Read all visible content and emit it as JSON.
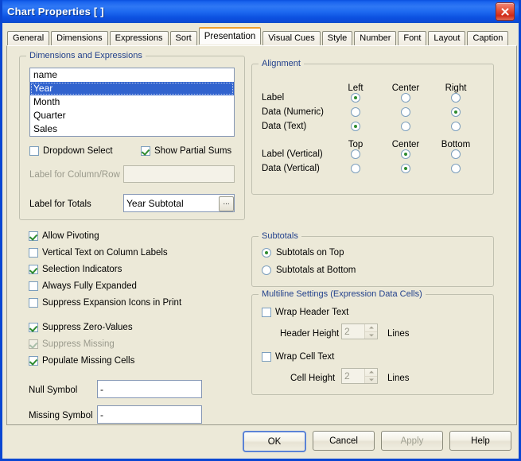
{
  "window": {
    "title": "Chart Properties [ ]",
    "close_icon": "close-icon"
  },
  "tabs": [
    {
      "label": "General",
      "active": false
    },
    {
      "label": "Dimensions",
      "active": false
    },
    {
      "label": "Expressions",
      "active": false
    },
    {
      "label": "Sort",
      "active": false
    },
    {
      "label": "Presentation",
      "active": true
    },
    {
      "label": "Visual Cues",
      "active": false
    },
    {
      "label": "Style",
      "active": false
    },
    {
      "label": "Number",
      "active": false
    },
    {
      "label": "Font",
      "active": false
    },
    {
      "label": "Layout",
      "active": false
    },
    {
      "label": "Caption",
      "active": false
    }
  ],
  "dimensions_group": {
    "legend": "Dimensions and Expressions",
    "list_items": [
      {
        "label": "name",
        "selected": false
      },
      {
        "label": "Year",
        "selected": true
      },
      {
        "label": "Month",
        "selected": false
      },
      {
        "label": "Quarter",
        "selected": false
      },
      {
        "label": "Sales",
        "selected": false
      }
    ],
    "dropdown_select": {
      "label": "Dropdown Select",
      "checked": false
    },
    "show_partial_sums": {
      "label": "Show Partial Sums",
      "checked": true
    },
    "label_column_row": {
      "label": "Label for Column/Row",
      "value": "",
      "disabled": true
    },
    "label_for_totals": {
      "label": "Label for Totals",
      "value": "Year Subtotal",
      "browse": "..."
    }
  },
  "alignment_group": {
    "legend": "Alignment",
    "headers_horizontal": [
      "Left",
      "Center",
      "Right"
    ],
    "headers_vertical": [
      "Top",
      "Center",
      "Bottom"
    ],
    "rows": [
      {
        "label": "Label",
        "selected": 0
      },
      {
        "label": "Data (Numeric)",
        "selected": 2
      },
      {
        "label": "Data (Text)",
        "selected": 0
      },
      {
        "label": "Label (Vertical)",
        "selected": 1
      },
      {
        "label": "Data (Vertical)",
        "selected": 1
      }
    ]
  },
  "options": [
    {
      "label": "Allow Pivoting",
      "checked": true,
      "disabled": false
    },
    {
      "label": "Vertical Text on Column Labels",
      "checked": false,
      "disabled": false
    },
    {
      "label": "Selection Indicators",
      "checked": true,
      "disabled": false
    },
    {
      "label": "Always Fully Expanded",
      "checked": false,
      "disabled": false
    },
    {
      "label": "Suppress Expansion Icons in Print",
      "checked": false,
      "disabled": false
    },
    {
      "label": "Suppress Zero-Values",
      "checked": true,
      "disabled": false
    },
    {
      "label": "Suppress Missing",
      "checked": true,
      "disabled": true
    },
    {
      "label": "Populate Missing Cells",
      "checked": true,
      "disabled": false
    }
  ],
  "symbols": {
    "null_symbol": {
      "label": "Null Symbol",
      "value": "-"
    },
    "missing_symbol": {
      "label": "Missing Symbol",
      "value": "-"
    }
  },
  "subtotals_group": {
    "legend": "Subtotals",
    "options": [
      {
        "label": "Subtotals on Top",
        "selected": true
      },
      {
        "label": "Subtotals at Bottom",
        "selected": false
      }
    ]
  },
  "multiline_group": {
    "legend": "Multiline Settings (Expression Data Cells)",
    "wrap_header_text": {
      "label": "Wrap Header Text",
      "checked": false
    },
    "header_height": {
      "label": "Header Height",
      "value": "2",
      "unit": "Lines",
      "disabled": true
    },
    "wrap_cell_text": {
      "label": "Wrap Cell Text",
      "checked": false
    },
    "cell_height": {
      "label": "Cell Height",
      "value": "2",
      "unit": "Lines",
      "disabled": true
    }
  },
  "buttons": [
    {
      "label": "OK",
      "default": true,
      "disabled": false
    },
    {
      "label": "Cancel",
      "default": false,
      "disabled": false
    },
    {
      "label": "Apply",
      "default": false,
      "disabled": true
    },
    {
      "label": "Help",
      "default": false,
      "disabled": false
    }
  ],
  "colors": {
    "titlebar_blue": "#0a50e0",
    "frame_blue": "#0a46d2",
    "dialog_bg": "#ece9d8",
    "legend_text": "#22418c",
    "selection_blue": "#3163ce",
    "check_green": "#2e8b2e",
    "active_tab_accent": "#f0a030",
    "close_red": "#cf2a18"
  }
}
